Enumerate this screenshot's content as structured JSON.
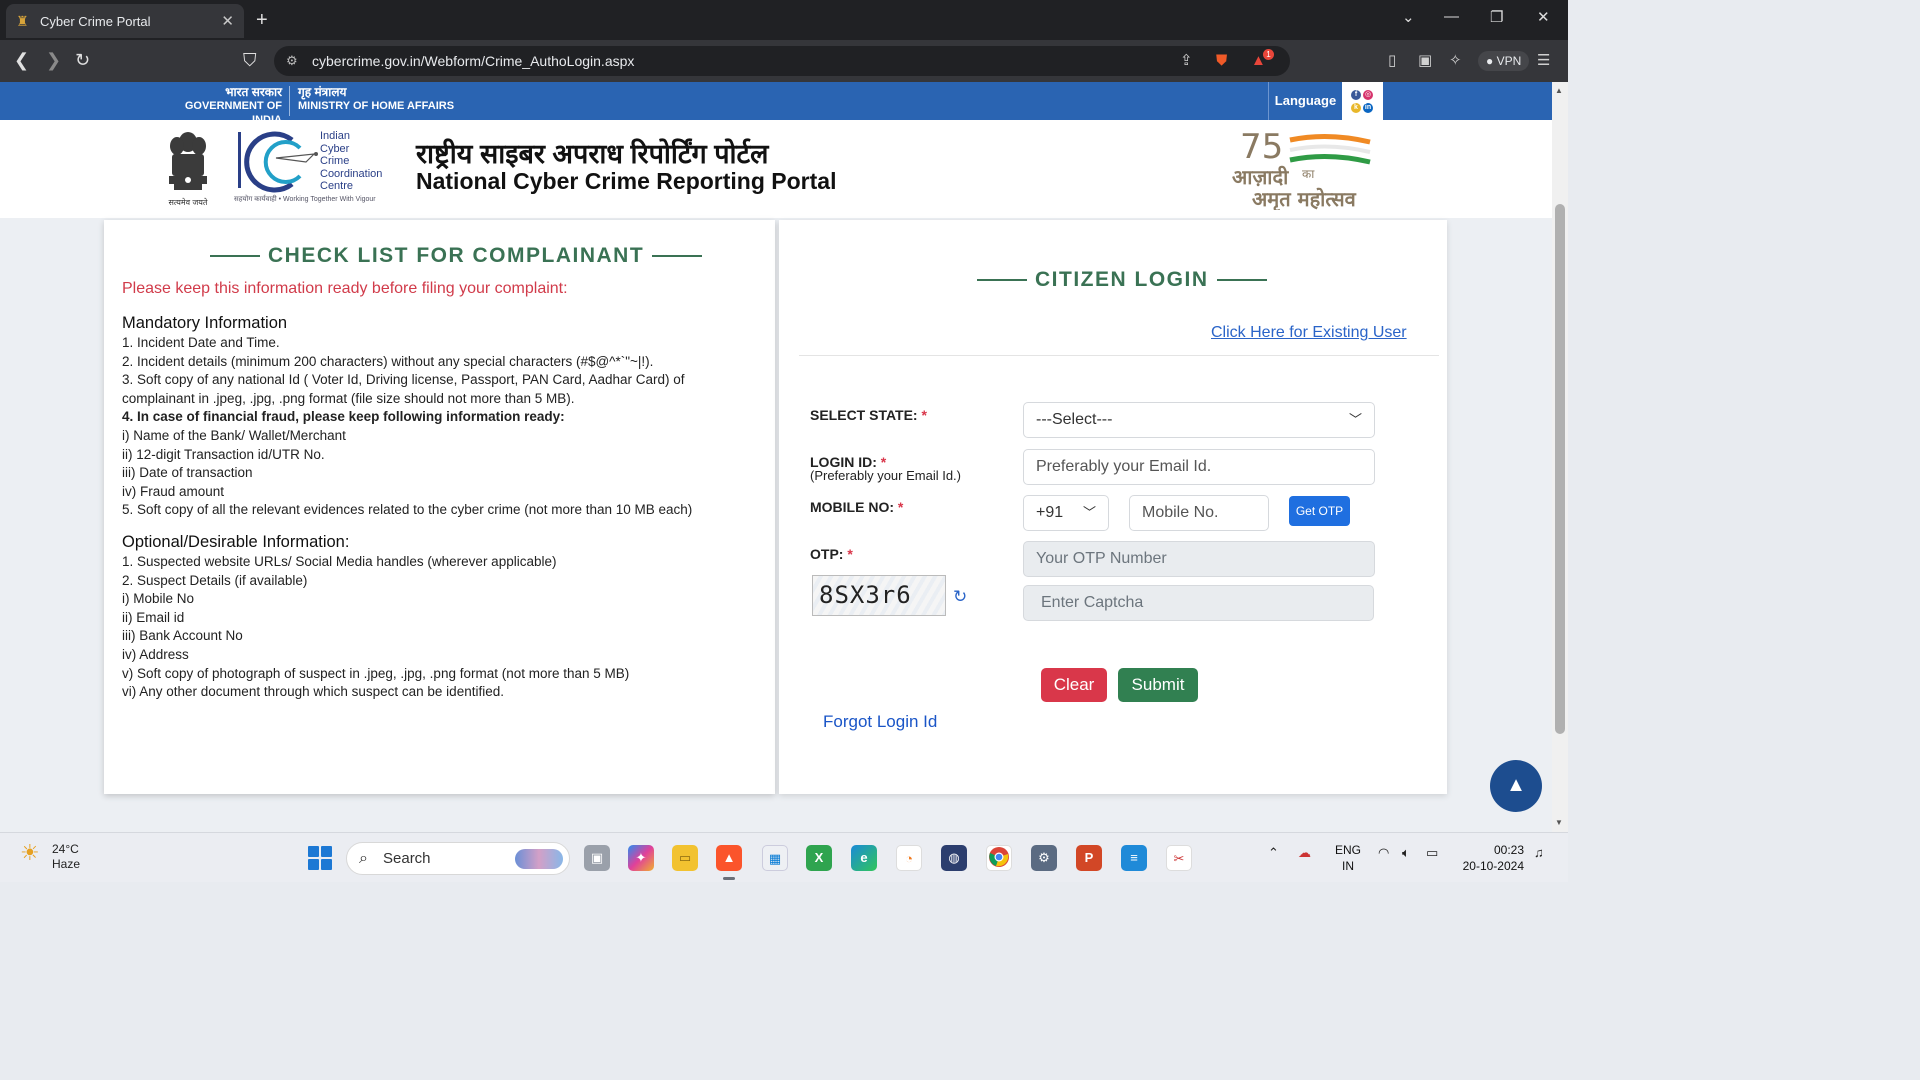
{
  "browser": {
    "tab_title": "Cyber Crime Portal",
    "url": "cybercrime.gov.in/Webform/Crime_AuthoLogin.aspx",
    "vpn_label": "VPN",
    "notification_count": "1"
  },
  "gov_bar": {
    "gov_hi": "भारत सरकार",
    "gov_en": "GOVERNMENT OF INDIA",
    "ministry_hi": "गृह मंत्रालय",
    "ministry_en": "MINISTRY OF HOME AFFAIRS",
    "language_label": "Language"
  },
  "header": {
    "emblem_caption": "सत्यमेव जयते",
    "i4c_lines": [
      "Indian",
      "Cyber",
      "Crime",
      "Coordination",
      "Centre"
    ],
    "i4c_tagline": "सहयोग कार्यवाही • Working Together With Vigour",
    "title_hi": "राष्ट्रीय साइबर अपराध रिपोर्टिंग पोर्टल",
    "title_en": "National Cyber Crime Reporting Portal",
    "azadi_line1": "आज़ादी",
    "azadi_ka": "का",
    "azadi_line2": "अमृत महोत्सव",
    "azadi_num": "75"
  },
  "checklist": {
    "heading": "CHECK LIST FOR COMPLAINANT",
    "warning": "Please keep this information ready before filing your complaint:",
    "mandatory_heading": "Mandatory Information",
    "mandatory_items": [
      "1. Incident Date and Time.",
      "2. Incident details (minimum 200 characters) without any special characters (#$@^*`\"~|!).",
      "3. Soft copy of any national Id ( Voter Id, Driving license, Passport, PAN Card, Aadhar Card) of",
      "complainant in .jpeg, .jpg, .png format (file size should not more than 5 MB).",
      "4. In case of financial fraud, please keep following information ready:",
      "i) Name of the Bank/ Wallet/Merchant",
      "ii) 12-digit Transaction id/UTR No.",
      "iii) Date of transaction",
      "iv) Fraud amount",
      "5. Soft copy of all the relevant evidences related to the cyber crime (not more than 10 MB each)"
    ],
    "optional_heading": "Optional/Desirable Information:",
    "optional_items": [
      "1. Suspected website URLs/ Social Media handles (wherever applicable)",
      "2. Suspect Details (if available)",
      "i) Mobile No",
      "ii) Email id",
      "iii) Bank Account No",
      "iv) Address",
      "v) Soft copy of photograph of suspect in .jpeg, .jpg, .png format (not more than 5 MB)",
      "vi) Any other document through which suspect can be identified."
    ]
  },
  "login": {
    "heading": "CITIZEN LOGIN",
    "existing_user_link": "Click Here for Existing User",
    "state_label": "SELECT STATE:",
    "state_value": "---Select---",
    "login_id_label": "LOGIN ID:",
    "login_id_hint": "(Preferably your Email Id.)",
    "login_id_placeholder": "Preferably your Email Id.",
    "mobile_label": "MOBILE NO:",
    "country_code": "+91",
    "mobile_placeholder": "Mobile No.",
    "get_otp": "Get OTP",
    "otp_label": "OTP:",
    "otp_placeholder": "Your OTP Number",
    "captcha_text": "8SX3r6",
    "captcha_placeholder": "Enter Captcha",
    "clear_label": "Clear",
    "submit_label": "Submit",
    "forgot_label": "Forgot Login Id",
    "required_mark": "*"
  },
  "taskbar": {
    "temperature": "24°C",
    "weather": "Haze",
    "search_label": "Search",
    "lang_1": "ENG",
    "lang_2": "IN",
    "time": "00:23",
    "date": "20-10-2024"
  },
  "colors": {
    "gov_blue": "#2a64b2",
    "heading_green": "#3a7254",
    "warning_red": "#d13b4a",
    "clear_red": "#d9374a",
    "submit_green": "#318051",
    "otp_blue": "#1f6fe0"
  }
}
